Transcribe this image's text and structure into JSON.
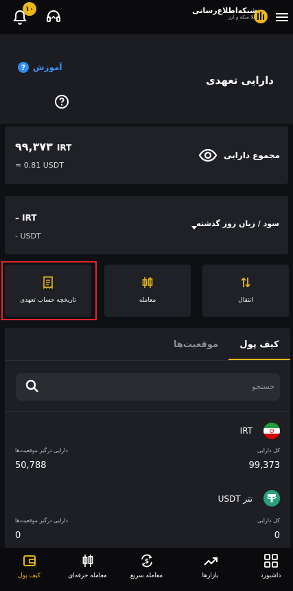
{
  "topbar": {
    "badge_count": "۱۰",
    "brand_line1": "شبکه‌اطلاع‌رسانی",
    "brand_line2": "طلا  سکه  و ارز"
  },
  "header": {
    "learn_label": "آموزش",
    "title": "دارایی تعهدی"
  },
  "total": {
    "label": "مجموع دارایی",
    "value": "۹۹,۳۷۳",
    "currency": "IRT",
    "usdt": "≈ 0.81 USDT"
  },
  "pnl": {
    "label": "سود / زیان روز گذشته",
    "value": "– IRT",
    "usdt": "- USDT"
  },
  "actions": {
    "history": "تاریخچه حساب تعهدی",
    "trade": "معامله",
    "transfer": "انتقال"
  },
  "tabs": {
    "wallet": "کیف پول",
    "positions": "موقعیت‌ها"
  },
  "search": {
    "placeholder": "جستجو"
  },
  "assets": [
    {
      "name": "IRT",
      "total_label": "کل دارایی",
      "total": "99,373",
      "in_positions_label": "دارایی درگیر موقعیت‌ها",
      "in_positions": "50,788"
    },
    {
      "name": "تتر  USDT",
      "total_label": "کل دارایی",
      "total": "0",
      "in_positions_label": "دارایی درگیر موقعیت‌ها",
      "in_positions": "0"
    }
  ],
  "bottom_nav": [
    {
      "label": "کیف پول",
      "icon": "wallet-icon",
      "active": true
    },
    {
      "label": "معامله حرفه‌ای",
      "icon": "candles-icon",
      "active": false
    },
    {
      "label": "معامله سریع",
      "icon": "exchange-icon",
      "active": false
    },
    {
      "label": "بازارها",
      "icon": "trend-icon",
      "active": false
    },
    {
      "label": "داشبورد",
      "icon": "dashboard-icon",
      "active": false
    }
  ],
  "colors": {
    "accent": "#e9b71a",
    "link": "#3b95f5",
    "highlight": "#e0262b",
    "card": "#1f2126"
  }
}
